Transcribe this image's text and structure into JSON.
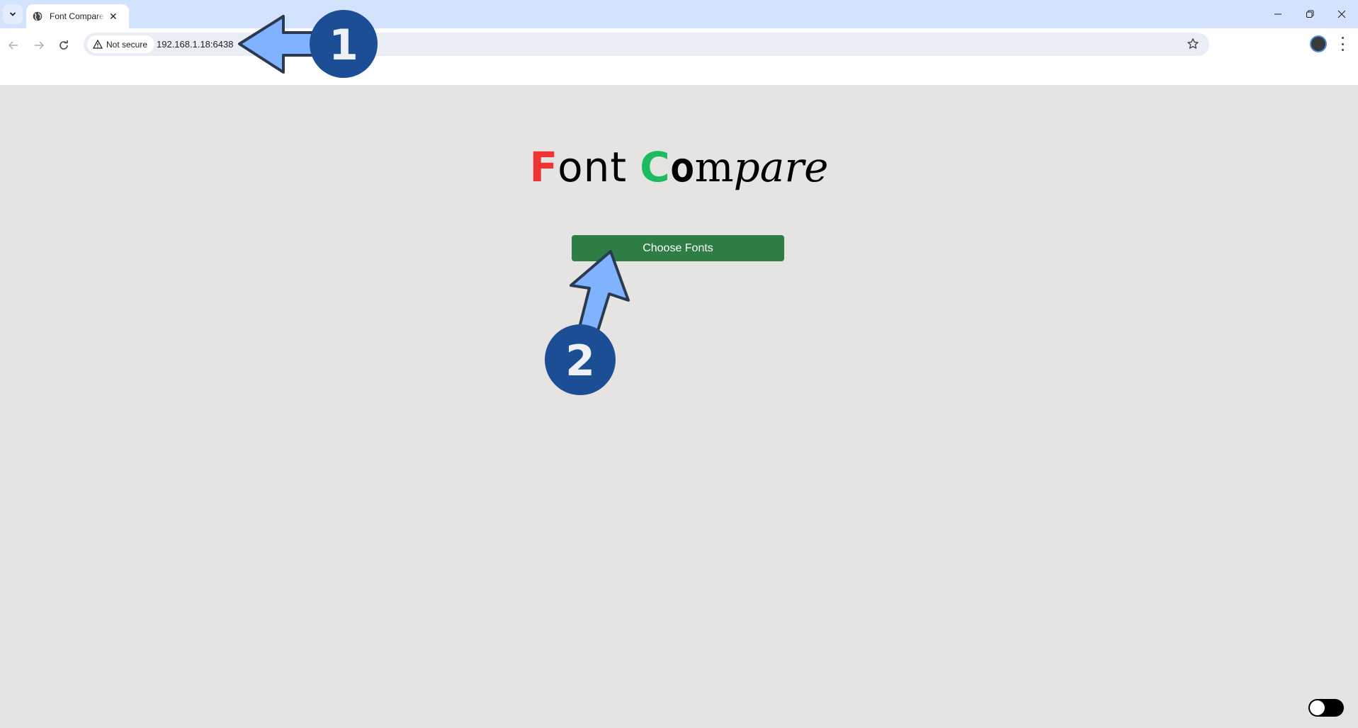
{
  "browser": {
    "tab": {
      "title": "Font Compare",
      "icon": "globe-icon"
    },
    "security_chip": "Not secure",
    "url": "192.168.1.18:6438",
    "window_controls": [
      "minimize",
      "restore",
      "close"
    ]
  },
  "page": {
    "logo": {
      "part1_initial": "F",
      "part1_rest": "ont",
      "part2_initial": "C",
      "part2_o": "o",
      "part2_m": "m",
      "part2_rest": "pare"
    },
    "choose_fonts_label": "Choose Fonts",
    "theme_toggle": {
      "state": "off"
    }
  },
  "annotations": [
    {
      "number": "1",
      "target": "address bar URL"
    },
    {
      "number": "2",
      "target": "Choose Fonts button"
    }
  ],
  "colors": {
    "logo_f": "#f03333",
    "logo_c": "#1dbb60",
    "button_bg": "#2e7d45",
    "page_bg": "#e5e4e2",
    "annotation_badge": "#1c4e96",
    "annotation_arrow": "#80b3ff"
  }
}
